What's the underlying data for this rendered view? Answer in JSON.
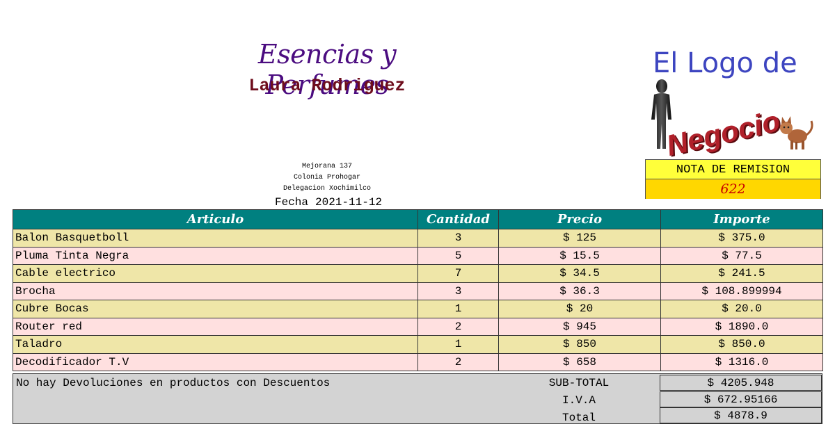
{
  "header": {
    "company": "Esencias y Perfumes",
    "owner": "Laura Rodriguez",
    "address": [
      "Mejorana 137",
      "Colonia Prohogar",
      "Delegacion Xochimilco"
    ],
    "date_label": "Fecha",
    "date": "2021-11-12"
  },
  "logo": {
    "line1": "El Logo de",
    "line2": "Negocio",
    "icons": [
      "person-figure-icon",
      "cat-icon"
    ]
  },
  "nota": {
    "title": "NOTA DE REMISION",
    "number": "622"
  },
  "table": {
    "headers": [
      "Articulo",
      "Cantidad",
      "Precio",
      "Importe"
    ],
    "rows": [
      {
        "articulo": "Balon Basquetboll",
        "cantidad": "3",
        "precio": "$ 125",
        "importe": "$ 375.0"
      },
      {
        "articulo": "Pluma Tinta Negra",
        "cantidad": "5",
        "precio": "$ 15.5",
        "importe": "$ 77.5"
      },
      {
        "articulo": "Cable electrico",
        "cantidad": "7",
        "precio": "$ 34.5",
        "importe": "$ 241.5"
      },
      {
        "articulo": "Brocha",
        "cantidad": "3",
        "precio": "$ 36.3",
        "importe": "$ 108.899994"
      },
      {
        "articulo": "Cubre Bocas",
        "cantidad": "1",
        "precio": "$ 20",
        "importe": "$ 20.0"
      },
      {
        "articulo": "Router red",
        "cantidad": "2",
        "precio": "$ 945",
        "importe": "$ 1890.0"
      },
      {
        "articulo": "Taladro",
        "cantidad": "1",
        "precio": "$ 850",
        "importe": "$ 850.0"
      },
      {
        "articulo": "Decodificador T.V",
        "cantidad": "2",
        "precio": "$ 658",
        "importe": "$ 1316.0"
      }
    ]
  },
  "footer": {
    "note": "No hay Devoluciones en productos con Descuentos",
    "subtotal_label": "SUB-TOTAL",
    "subtotal": "$ 4205.948",
    "iva_label": "I.V.A",
    "iva": "$ 672.95166",
    "total_label": "Total",
    "total": "$ 4878.9"
  },
  "colors": {
    "header_bg": "#008080",
    "row_a": "#efe6a8",
    "row_b": "#ffe0e0",
    "footer_bg": "#d3d3d3",
    "nota_bg": "#ffff3a",
    "nota_number_bg": "#ffd700",
    "company_color": "#4b0c80",
    "owner_color": "#6e0d1c"
  }
}
